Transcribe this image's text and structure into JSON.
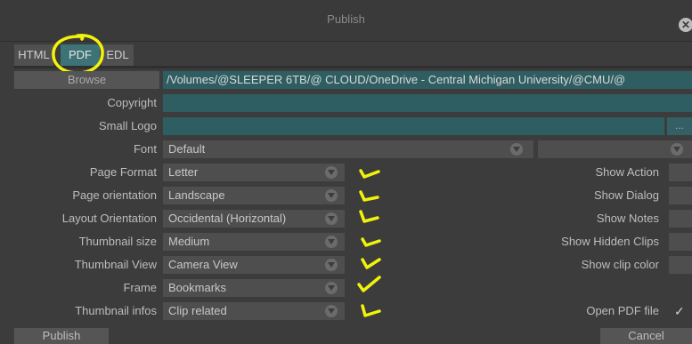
{
  "window": {
    "title": "Publish",
    "close_icon": "close-icon"
  },
  "tabs": [
    {
      "label": "HTML",
      "active": false
    },
    {
      "label": "PDF",
      "active": true
    },
    {
      "label": "EDL",
      "active": false
    }
  ],
  "browse": {
    "button_label": "Browse",
    "path": "/Volumes/@SLEEPER 6TB/@ CLOUD/OneDrive - Central Michigan University/@CMU/@"
  },
  "fields": {
    "copyright_label": "Copyright",
    "small_logo_label": "Small Logo",
    "small_logo_button": "...",
    "font_label": "Font",
    "font_value": "Default"
  },
  "options": [
    {
      "label": "Page Format",
      "value": "Letter"
    },
    {
      "label": "Page orientation",
      "value": "Landscape"
    },
    {
      "label": "Layout Orientation",
      "value": "Occidental (Horizontal)"
    },
    {
      "label": "Thumbnail size",
      "value": "Medium"
    },
    {
      "label": "Thumbnail View",
      "value": "Camera View"
    },
    {
      "label": "Frame",
      "value": "Bookmarks"
    },
    {
      "label": "Thumbnail infos",
      "value": "Clip related"
    }
  ],
  "checkboxes": [
    {
      "label": "Show Action",
      "checked": false
    },
    {
      "label": "Show Dialog",
      "checked": false
    },
    {
      "label": "Show Notes",
      "checked": false
    },
    {
      "label": "Show Hidden Clips",
      "checked": false
    },
    {
      "label": "Show clip color",
      "checked": false
    },
    {
      "label": "Open PDF file",
      "checked": true,
      "mark": "✓"
    }
  ],
  "footer": {
    "publish_label": "Publish",
    "cancel_label": "Cancel"
  },
  "colors": {
    "background": "#3c3c3c",
    "accent_teal": "#2f5e62",
    "annotation_yellow": "#f2f20a"
  }
}
